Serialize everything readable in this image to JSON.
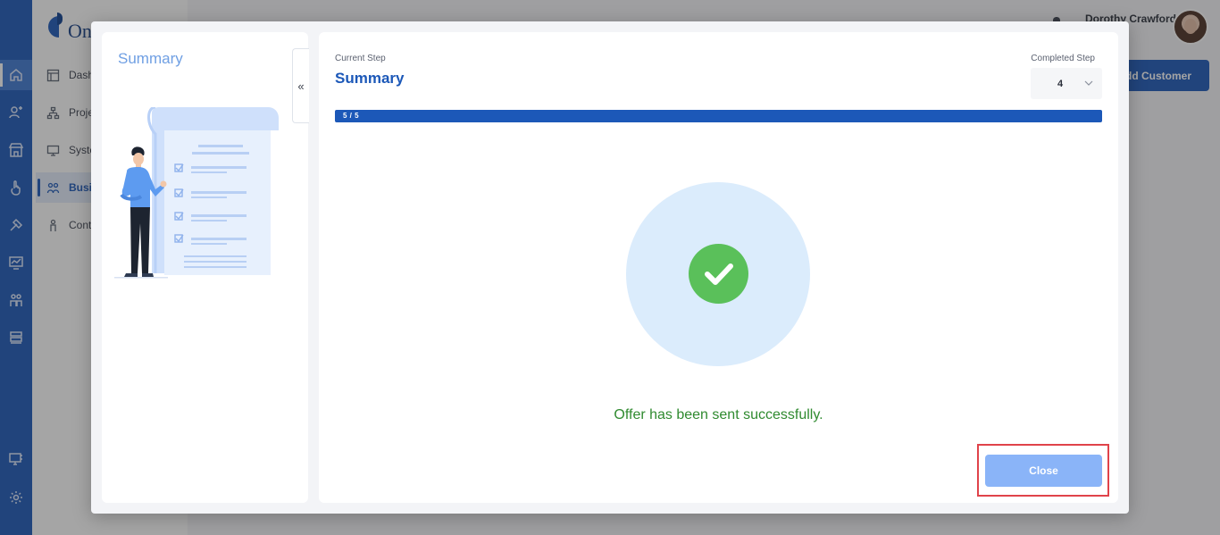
{
  "app": {
    "logo_text": "One",
    "user_name": "Dorothy Crawford",
    "add_customer_label": "Add Customer",
    "nav_items": [
      {
        "label": "Dash",
        "icon": "dashboard-icon"
      },
      {
        "label": "Proje",
        "icon": "project-icon"
      },
      {
        "label": "Syste",
        "icon": "system-icon"
      },
      {
        "label": "Busi",
        "icon": "business-icon",
        "active": true
      },
      {
        "label": "Cont",
        "icon": "contact-icon"
      }
    ],
    "rail_icons": [
      "home-icon",
      "customers-icon",
      "store-icon",
      "touch-icon",
      "tools-icon",
      "analytics-icon",
      "team-icon",
      "storage-icon",
      "monitor-icon",
      "settings-icon"
    ]
  },
  "modal": {
    "left_title": "Summary",
    "collapse_glyph": "«",
    "current_step_label": "Current Step",
    "current_step_title": "Summary",
    "completed_step_label": "Completed Step",
    "completed_step_value": "4",
    "progress": {
      "text": "5 / 5",
      "fraction": 1.0
    },
    "success_message": "Offer has been sent successfully.",
    "close_label": "Close"
  },
  "colors": {
    "primary": "#1c58b8",
    "success_green": "#5ac05a",
    "success_text": "#2f8a2f",
    "close_button": "#8ab4f8",
    "highlight": "#e0434a"
  }
}
